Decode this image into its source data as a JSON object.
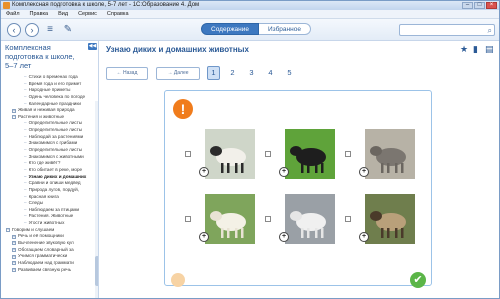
{
  "window": {
    "title": "Комплексная подготовка к школе, 5-7 лет - 1С:Образование 4. Дом"
  },
  "menu": [
    "Файл",
    "Правка",
    "Вид",
    "Сервис",
    "Справка"
  ],
  "toolbar": {
    "tabs": [
      {
        "label": "Содержание",
        "active": true
      },
      {
        "label": "Избранное",
        "active": false
      }
    ],
    "search_placeholder": ""
  },
  "sidebar": {
    "heading": "Комплексная подготовка к школе, 5–7 лет",
    "tree": [
      {
        "label": "Стихи о временах года",
        "level": 2
      },
      {
        "label": "Время года и его примет",
        "level": 2
      },
      {
        "label": "Народные приметы",
        "level": 2
      },
      {
        "label": "Одень человека по погоде",
        "level": 2
      },
      {
        "label": "Календарные праздники",
        "level": 2
      },
      {
        "label": "Живая и неживая природа",
        "level": 1,
        "toggle": "+"
      },
      {
        "label": "Растения и животные",
        "level": 1,
        "toggle": "−"
      },
      {
        "label": "Определительные листы",
        "level": 2
      },
      {
        "label": "Определительные листы",
        "level": 2
      },
      {
        "label": "Наблюдай за растениями",
        "level": 2
      },
      {
        "label": "Знакомимся с грибами",
        "level": 2
      },
      {
        "label": "Определительные листы",
        "level": 2
      },
      {
        "label": "Знакомимся с животными",
        "level": 2
      },
      {
        "label": "Кто где живёт?",
        "level": 2
      },
      {
        "label": "Кто обитает в реке, море",
        "level": 2
      },
      {
        "label": "Узнаю диких и домашних",
        "level": 2,
        "bold": true
      },
      {
        "label": "Сравни и опиши медвед",
        "level": 2
      },
      {
        "label": "Природа лугов, пордуй,",
        "level": 2
      },
      {
        "label": "Красная книга",
        "level": 2
      },
      {
        "label": "Следы",
        "level": 2
      },
      {
        "label": "Наблюдаем за птицами",
        "level": 2
      },
      {
        "label": "Растения. Животные",
        "level": 2
      },
      {
        "label": "Угости животных",
        "level": 2
      },
      {
        "label": "Говорим и слушаем",
        "level": 0,
        "toggle": "−"
      },
      {
        "label": "Речь и её помощники",
        "level": 1,
        "toggle": "+"
      },
      {
        "label": "Вычленение звуковую кул",
        "level": 1,
        "toggle": "+"
      },
      {
        "label": "Обогащаем словарный за",
        "level": 1,
        "toggle": "+"
      },
      {
        "label": "Учимся грамматически",
        "level": 1,
        "toggle": "+"
      },
      {
        "label": "Наблюдаем над граммати",
        "level": 1,
        "toggle": "+"
      },
      {
        "label": "Развиваем связную речь",
        "level": 1,
        "toggle": "+"
      }
    ]
  },
  "main": {
    "title": "Узнаю диких и домашних животных",
    "back_label": "Назад",
    "forward_label": "Далее",
    "pages": [
      "1",
      "2",
      "3",
      "4",
      "5"
    ],
    "active_page": "1",
    "animals": [
      {
        "name": "sheep",
        "bg": "#cfd6c9",
        "body": "#f2f0ea",
        "head": "#2b2b2b"
      },
      {
        "name": "black-cat",
        "bg": "#5fa33a",
        "body": "#1e1e1e",
        "head": "#1e1e1e"
      },
      {
        "name": "donkey",
        "bg": "#b7b2a6",
        "body": "#7b7670",
        "head": "#6b6660"
      },
      {
        "name": "white-sheep",
        "bg": "#7fa55c",
        "body": "#f4f1e6",
        "head": "#e9e3d4"
      },
      {
        "name": "white-tiger",
        "bg": "#9aa0a6",
        "body": "#f0f0f0",
        "head": "#e6e6e6"
      },
      {
        "name": "cows",
        "bg": "#6f7e4d",
        "body": "#b9a07a",
        "head": "#4a3a2a"
      }
    ]
  }
}
